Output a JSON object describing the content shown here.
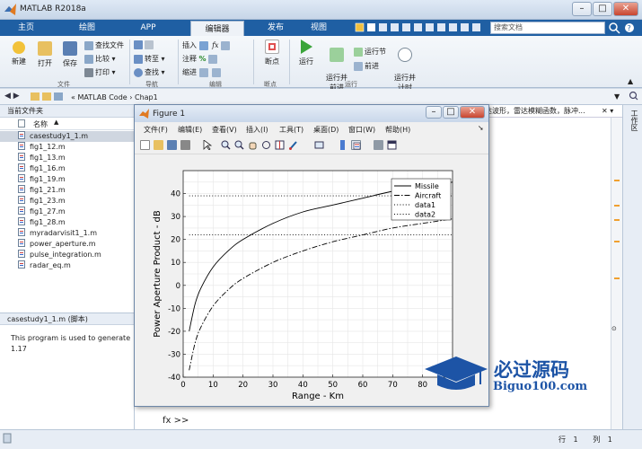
{
  "window": {
    "title": "MATLAB R2018a"
  },
  "tabs": [
    {
      "label": "主页"
    },
    {
      "label": "绘图"
    },
    {
      "label": "APP"
    },
    {
      "label": "编辑器"
    },
    {
      "label": "发布"
    },
    {
      "label": "视图"
    }
  ],
  "search": {
    "placeholder": "搜索文档"
  },
  "ribbon": {
    "new": "新建",
    "open": "打开",
    "save": "保存",
    "find_files": "查找文件",
    "compare": "比较",
    "print": "打印",
    "goto": "转至",
    "find": "查找",
    "insert": "插入",
    "comment": "注释",
    "indent": "缩进",
    "breakpoints": "断点",
    "run": "运行",
    "run_advance": "运行并\n前进",
    "run_section": "运行节",
    "advance": "前进",
    "run_time": "运行并\n计时",
    "groups": {
      "file": "文件",
      "navigate": "导航",
      "edit": "编辑",
      "breakpoints": "断点",
      "run": "运行"
    }
  },
  "address": {
    "path": "«  MATLAB Code  ›  Chap1"
  },
  "current_folder": {
    "title": "当前文件夹",
    "column_name": "名称",
    "files": [
      "casestudy1_1.m",
      "fig1_12.m",
      "fig1_13.m",
      "fig1_16.m",
      "fig1_19.m",
      "fig1_21.m",
      "fig1_23.m",
      "fig1_27.m",
      "fig1_28.m",
      "myradarvisit1_1.m",
      "power_aperture.m",
      "pulse_integration.m",
      "radar_eq.m"
    ],
    "selected_index": 0
  },
  "details": {
    "header": "casestudy1_1.m  (脚本)",
    "text": "This program is used to generate",
    "text2": "1.17"
  },
  "editor_strip": {
    "text": "达波形，雷达模糊函数，脉冲..."
  },
  "workspace_label": "工作区",
  "command": {
    "prompt": "fx  >>"
  },
  "status": {
    "row_label": "行",
    "row": "1",
    "col_label": "列",
    "col": "1"
  },
  "figure": {
    "title": "Figure 1",
    "menu": [
      "文件(F)",
      "编辑(E)",
      "查看(V)",
      "插入(I)",
      "工具(T)",
      "桌面(D)",
      "窗口(W)",
      "帮助(H)"
    ]
  },
  "watermark": {
    "text": "必过源码",
    "sub": "Biguo100.com"
  },
  "chart_data": {
    "type": "line",
    "xlabel": "Range - Km",
    "ylabel": "Power Aperture Product - dB",
    "xlim": [
      0,
      90
    ],
    "ylim": [
      -40,
      50
    ],
    "xticks": [
      0,
      10,
      20,
      30,
      40,
      50,
      60,
      70,
      80
    ],
    "yticks": [
      -40,
      -30,
      -20,
      -10,
      0,
      10,
      20,
      30,
      40
    ],
    "grid": true,
    "legend_position": "top-right",
    "series": [
      {
        "name": "Missile",
        "style": "solid",
        "x": [
          2,
          4,
          6,
          10,
          15,
          20,
          30,
          40,
          50,
          60,
          70,
          80,
          90
        ],
        "y": [
          -20,
          -8,
          -1,
          8,
          15,
          20,
          27,
          32,
          35,
          38,
          41,
          43,
          45
        ]
      },
      {
        "name": "Aircraft",
        "style": "dashdot",
        "x": [
          2,
          4,
          6,
          10,
          15,
          20,
          30,
          40,
          50,
          60,
          70,
          80,
          90
        ],
        "y": [
          -37,
          -25,
          -18,
          -9,
          -2,
          3,
          10,
          15,
          19,
          22,
          25,
          27,
          29
        ]
      },
      {
        "name": "data1",
        "style": "dotted",
        "x": [
          2,
          90
        ],
        "y": [
          39,
          39
        ]
      },
      {
        "name": "data2",
        "style": "dotted",
        "x": [
          2,
          90
        ],
        "y": [
          22,
          22
        ]
      }
    ]
  }
}
